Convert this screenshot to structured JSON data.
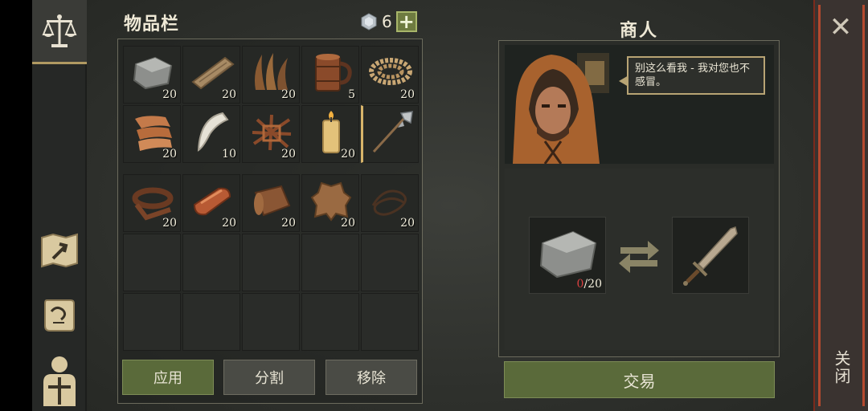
{
  "inventory": {
    "title": "物品栏",
    "gem_count": "6",
    "plus_label": "+",
    "rows_top": [
      [
        {
          "icon": "stone-icon",
          "qty": "20"
        },
        {
          "icon": "wood-plank-icon",
          "qty": "20"
        },
        {
          "icon": "plant-fiber-icon",
          "qty": "20"
        },
        {
          "icon": "wooden-mug-icon",
          "qty": "5"
        },
        {
          "icon": "rope-coil-icon",
          "qty": "20"
        }
      ],
      [
        {
          "icon": "cloth-icon",
          "qty": "20"
        },
        {
          "icon": "fang-icon",
          "qty": "10"
        },
        {
          "icon": "twig-bundle-icon",
          "qty": "20"
        },
        {
          "icon": "candle-icon",
          "qty": "20"
        },
        {
          "icon": "halberd-icon",
          "qty": ""
        }
      ]
    ],
    "rows_bottom": [
      [
        {
          "icon": "leather-strap-icon",
          "qty": "20"
        },
        {
          "icon": "copper-ingot-icon",
          "qty": "20"
        },
        {
          "icon": "leather-roll-icon",
          "qty": "20"
        },
        {
          "icon": "animal-hide-icon",
          "qty": "20"
        },
        {
          "icon": "thread-icon",
          "qty": "20"
        }
      ]
    ],
    "buttons": {
      "apply": "应用",
      "split": "分割",
      "remove": "移除"
    }
  },
  "merchant": {
    "title": "商人",
    "speech": "别这么看我 - 我对您也不感冒。",
    "give_item": {
      "icon": "stone-icon",
      "have": "0",
      "need": "/20"
    },
    "receive_item": {
      "icon": "sword-icon"
    },
    "trade_button": "交易"
  },
  "close": {
    "label": "关闭",
    "icon": "close-icon"
  },
  "colors": {
    "accent_green": "#5a6a3a",
    "gold_border": "#b8a474",
    "red_edge": "#b4492f"
  }
}
